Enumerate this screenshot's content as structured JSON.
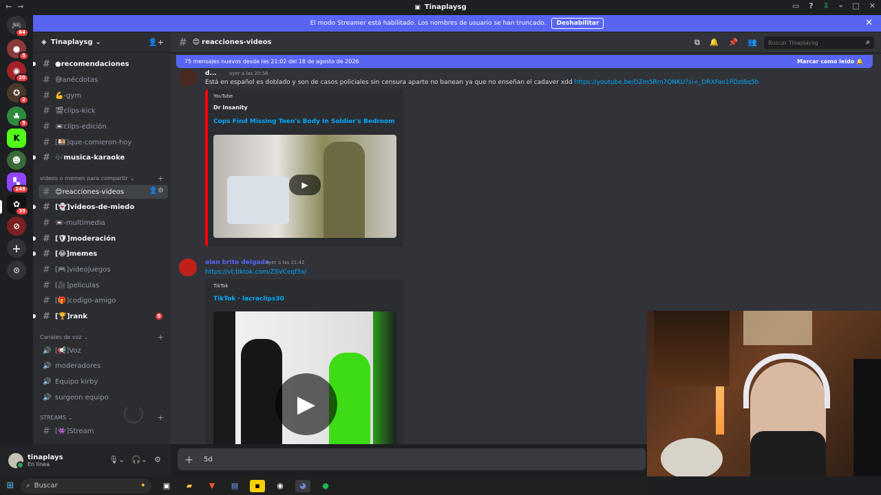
{
  "window": {
    "title": "Tinaplaysg"
  },
  "banner": {
    "text": "El modo Streamer está habilitado. Los nombres de usuario se han truncado.",
    "button": "Deshabilitar"
  },
  "servers": {
    "badges": [
      "64",
      "5",
      "20",
      "2",
      "5",
      "146",
      "35"
    ]
  },
  "server": {
    "name": "Tinaplaysg"
  },
  "channels": [
    {
      "name": "recomendaciones",
      "icon": "●"
    },
    {
      "name": "anécdotas",
      "icon": "😅"
    },
    {
      "name": "-gym",
      "icon": "💪"
    },
    {
      "name": "clips-kick",
      "icon": "🎬"
    },
    {
      "name": "clips-edición",
      "icon": "📼"
    },
    {
      "name": "que-comieron-hoy",
      "icon": "[🍱]"
    },
    {
      "name": "musica-karaoke",
      "icon": "🎶"
    }
  ],
  "category1": "videos o memes para compartir",
  "channels2": [
    {
      "name": "reacciones-videos",
      "icon": "😊"
    },
    {
      "name": "videos-de-miedo",
      "icon": "[👻]"
    },
    {
      "name": "-multimedia",
      "icon": "📼"
    },
    {
      "name": "moderación",
      "icon": "[🛡]"
    },
    {
      "name": "memes",
      "icon": "[😂]"
    },
    {
      "name": "videojuegos",
      "icon": "[🎮]"
    },
    {
      "name": "peliculas",
      "icon": "[🎥]"
    },
    {
      "name": "codigo-amigo",
      "icon": "[🎁]"
    },
    {
      "name": "rank",
      "icon": "[🏆]",
      "badge": "5"
    }
  ],
  "category2": "Canales de voz",
  "voice": [
    {
      "name": "Voz",
      "icon": "[📢]"
    },
    {
      "name": "moderadores",
      "icon": ""
    },
    {
      "name": "Equipo kirby",
      "icon": ""
    },
    {
      "name": "surgeon equipo",
      "icon": ""
    }
  ],
  "category3": "STREAMS",
  "streams": [
    {
      "name": "Stream",
      "icon": "[👾]"
    }
  ],
  "user": {
    "name": "tinaplays",
    "status": "En línea"
  },
  "chat": {
    "channel": "reacciones-videos",
    "search_placeholder": "Buscar Tinaplaysg",
    "new_messages": "75 mensajes nuevos desde las 21:02 del 18 de agosto de 2026",
    "mark_read": "Marcar como leído",
    "messages": [
      {
        "author": "d...",
        "time": "ayer a las 20:56",
        "text": "Está en español es doblado y son de casos policiales sin censura aparte no banean ya que no enseñan el cadaver xdd",
        "link": "https://youtube.be/DZm5Rm7QNKU?si=_DRXFao1PDzI8q5b",
        "embed": {
          "provider": "YouTube",
          "author": "Dr Insanity",
          "title": "Cops Find Missing Teen's Body In Soldier's Bedroom"
        }
      },
      {
        "author": "alan brito delgado",
        "time": "ayer a las 21:42",
        "link": "https://vt.tiktok.com/ZSVCeqf5x/",
        "embed": {
          "provider": "TikTok",
          "title": "TikTok · lacraclips30"
        }
      }
    ],
    "composer_value": "5d"
  },
  "taskbar": {
    "search": "Buscar"
  },
  "colors": {
    "accent": "#5865f2",
    "link": "#00a8fc",
    "youtube": "#ff0000"
  }
}
